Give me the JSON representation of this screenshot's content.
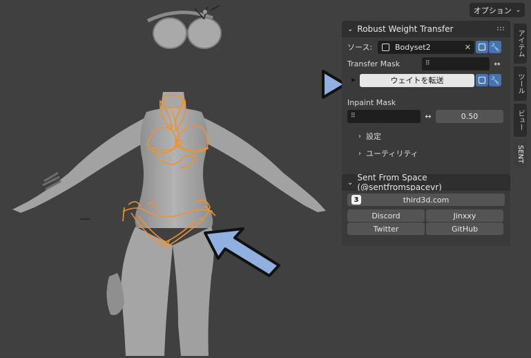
{
  "toolbar": {
    "options_label": "オプション"
  },
  "tabs": [
    "アイテム",
    "ツール",
    "ビュー",
    "SENT"
  ],
  "robust_panel": {
    "title": "Robust Weight Transfer",
    "source_label": "ソース:",
    "source_value": "Bodyset2",
    "transfer_mask_label": "Transfer Mask",
    "transfer_button": "ウェイトを転送",
    "inpaint_mask_label": "Inpaint Mask",
    "inpaint_value": "0.50",
    "settings_label": "設定",
    "utility_label": "ユーティリティ"
  },
  "sent_panel": {
    "title": "Sent From Space (@sentfromspacevr)",
    "website": "third3d.com",
    "links": [
      "Discord",
      "Jinxxy",
      "Twitter",
      "GitHub"
    ]
  },
  "colors": {
    "accent_blue": "#4772b3",
    "arrow_blue": "#8fb0e0",
    "selection_orange": "#f0922e"
  }
}
